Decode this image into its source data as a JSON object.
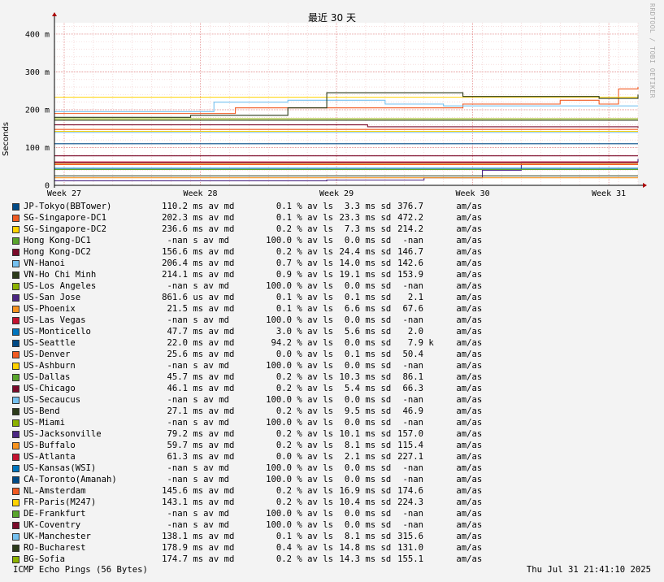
{
  "chart_data": {
    "type": "line",
    "title": "最近 30 天",
    "ylabel": "Seconds",
    "watermark": "RRDTOOL / TOBI OETIKER",
    "ylim": [
      0,
      430
    ],
    "yticks": [
      {
        "value": 0,
        "label": "0"
      },
      {
        "value": 100,
        "label": "100 m"
      },
      {
        "value": 200,
        "label": "200 m"
      },
      {
        "value": 300,
        "label": "300 m"
      },
      {
        "value": 400,
        "label": "400 m"
      }
    ],
    "xticks": [
      {
        "value": 0.5,
        "label": "Week 27"
      },
      {
        "value": 7.5,
        "label": "Week 28"
      },
      {
        "value": 14.5,
        "label": "Week 29"
      },
      {
        "value": 21.5,
        "label": "Week 30"
      },
      {
        "value": 28.5,
        "label": "Week 31"
      }
    ],
    "xlim": [
      0,
      30
    ],
    "grid": true,
    "series": [
      {
        "name": "JP-Tokyo(BBTower)",
        "color": "#004a86",
        "av": "110.2",
        "avu": "ms",
        "ls": "0.1",
        "sd": "3.3",
        "sdu": "ms",
        "sdv": "376.7",
        "sdvu": "",
        "levels": [
          [
            0,
            110
          ],
          [
            30,
            110
          ]
        ]
      },
      {
        "name": "SG-Singapore-DC1",
        "color": "#f15a22",
        "av": "202.3",
        "avu": "ms",
        "ls": "0.1",
        "sd": "23.3",
        "sdu": "ms",
        "sdv": "472.2",
        "sdvu": "",
        "levels": [
          [
            0,
            190
          ],
          [
            9,
            190
          ],
          [
            9.3,
            205
          ],
          [
            20,
            205
          ],
          [
            21,
            215
          ],
          [
            26,
            225
          ],
          [
            28,
            215
          ],
          [
            29,
            255
          ],
          [
            30,
            260
          ]
        ]
      },
      {
        "name": "SG-Singapore-DC2",
        "color": "#ffd200",
        "av": "236.6",
        "avu": "ms",
        "ls": "0.2",
        "sd": "7.3",
        "sdu": "ms",
        "sdv": "214.2",
        "sdvu": "",
        "levels": [
          [
            0,
            233
          ],
          [
            30,
            232
          ]
        ]
      },
      {
        "name": "Hong Kong-DC1",
        "color": "#59a52c",
        "av": "-nan",
        "avu": "s",
        "ls": "100.0",
        "sd": "0.0",
        "sdu": "ms",
        "sdv": "-nan",
        "sdvu": "",
        "levels": []
      },
      {
        "name": "Hong Kong-DC2",
        "color": "#7b0a2a",
        "av": "156.6",
        "avu": "ms",
        "ls": "0.2",
        "sd": "24.4",
        "sdu": "ms",
        "sdv": "146.7",
        "sdvu": "",
        "levels": [
          [
            0,
            160
          ],
          [
            16,
            160
          ],
          [
            16.1,
            155
          ],
          [
            30,
            152
          ]
        ]
      },
      {
        "name": "VN-Hanoi",
        "color": "#75c1f0",
        "av": "206.4",
        "avu": "ms",
        "ls": "0.7",
        "sd": "14.0",
        "sdu": "ms",
        "sdv": "142.6",
        "sdvu": "",
        "levels": [
          [
            0,
            195
          ],
          [
            8,
            195
          ],
          [
            8.2,
            220
          ],
          [
            12,
            225
          ],
          [
            17,
            215
          ],
          [
            20,
            210
          ],
          [
            30,
            210
          ]
        ]
      },
      {
        "name": "VN-Ho Chi Minh",
        "color": "#2c3b1a",
        "av": "214.1",
        "avu": "ms",
        "ls": "0.9",
        "sd": "19.1",
        "sdu": "ms",
        "sdv": "153.9",
        "sdvu": "",
        "levels": [
          [
            0,
            180
          ],
          [
            7,
            185
          ],
          [
            8,
            185
          ],
          [
            12,
            205
          ],
          [
            14,
            245
          ],
          [
            20,
            245
          ],
          [
            21,
            235
          ],
          [
            28,
            230
          ],
          [
            30,
            240
          ]
        ]
      },
      {
        "name": "US-Los Angeles",
        "color": "#8cb200",
        "av": "-nan",
        "avu": "s",
        "ls": "100.0",
        "sd": "0.0",
        "sdu": "ms",
        "sdv": "-nan",
        "sdvu": "",
        "levels": []
      },
      {
        "name": "US-San Jose",
        "color": "#4b2683",
        "av": "861.6",
        "avu": "us",
        "ls": "0.1",
        "sd": "0.1",
        "sdu": "ms",
        "sdv": "2.1",
        "sdvu": "",
        "levels": [
          [
            0,
            12
          ],
          [
            14,
            14
          ],
          [
            19,
            20
          ],
          [
            22,
            40
          ],
          [
            24,
            62
          ],
          [
            30,
            70
          ]
        ]
      },
      {
        "name": "US-Phoenix",
        "color": "#f7931e",
        "av": "21.5",
        "avu": "ms",
        "ls": "0.1",
        "sd": "6.6",
        "sdu": "ms",
        "sdv": "67.6",
        "sdvu": "",
        "levels": [
          [
            0,
            20
          ],
          [
            30,
            20
          ]
        ]
      },
      {
        "name": "US-Las Vegas",
        "color": "#c4122f",
        "av": "-nan",
        "avu": "s",
        "ls": "100.0",
        "sd": "0.0",
        "sdu": "ms",
        "sdv": "-nan",
        "sdvu": "",
        "levels": []
      },
      {
        "name": "US-Monticello",
        "color": "#0075be",
        "av": "47.7",
        "avu": "ms",
        "ls": "3.0",
        "sd": "5.6",
        "sdu": "ms",
        "sdv": "2.0",
        "sdvu": "",
        "levels": [
          [
            0,
            45
          ],
          [
            30,
            45
          ]
        ]
      },
      {
        "name": "US-Seattle",
        "color": "#004a86",
        "av": "22.0",
        "avu": "ms",
        "ls": "94.2",
        "sd": "0.0",
        "sdu": "ms",
        "sdv": "7.9",
        "sdvu": "k",
        "levels": []
      },
      {
        "name": "US-Denver",
        "color": "#f15a22",
        "av": "25.6",
        "avu": "ms",
        "ls": "0.0",
        "sd": "0.1",
        "sdu": "ms",
        "sdv": "50.4",
        "sdvu": "",
        "levels": [
          [
            0,
            55
          ],
          [
            30,
            55
          ]
        ]
      },
      {
        "name": "US-Ashburn",
        "color": "#ffd200",
        "av": "-nan",
        "avu": "s",
        "ls": "100.0",
        "sd": "0.0",
        "sdu": "ms",
        "sdv": "-nan",
        "sdvu": "",
        "levels": []
      },
      {
        "name": "US-Dallas",
        "color": "#59a52c",
        "av": "45.7",
        "avu": "ms",
        "ls": "0.2",
        "sd": "10.3",
        "sdu": "ms",
        "sdv": "86.1",
        "sdvu": "",
        "levels": [
          [
            0,
            42
          ],
          [
            30,
            42
          ]
        ]
      },
      {
        "name": "US-Chicago",
        "color": "#7b0a2a",
        "av": "46.1",
        "avu": "ms",
        "ls": "0.2",
        "sd": "5.4",
        "sdu": "ms",
        "sdv": "66.3",
        "sdvu": "",
        "levels": [
          [
            0,
            78
          ],
          [
            30,
            78
          ]
        ]
      },
      {
        "name": "US-Secaucus",
        "color": "#75c1f0",
        "av": "-nan",
        "avu": "s",
        "ls": "100.0",
        "sd": "0.0",
        "sdu": "ms",
        "sdv": "-nan",
        "sdvu": "",
        "levels": []
      },
      {
        "name": "US-Bend",
        "color": "#2c3b1a",
        "av": "27.1",
        "avu": "ms",
        "ls": "0.2",
        "sd": "9.5",
        "sdu": "ms",
        "sdv": "46.9",
        "sdvu": "",
        "levels": [
          [
            0,
            25
          ],
          [
            30,
            25
          ]
        ]
      },
      {
        "name": "US-Miami",
        "color": "#8cb200",
        "av": "-nan",
        "avu": "s",
        "ls": "100.0",
        "sd": "0.0",
        "sdu": "ms",
        "sdv": "-nan",
        "sdvu": "",
        "levels": []
      },
      {
        "name": "US-Jacksonville",
        "color": "#4b2683",
        "av": "79.2",
        "avu": "ms",
        "ls": "0.2",
        "sd": "10.1",
        "sdu": "ms",
        "sdv": "157.0",
        "sdvu": "",
        "levels": [
          [
            0,
            60
          ],
          [
            30,
            60
          ]
        ]
      },
      {
        "name": "US-Buffalo",
        "color": "#f7931e",
        "av": "59.7",
        "avu": "ms",
        "ls": "0.2",
        "sd": "8.1",
        "sdu": "ms",
        "sdv": "115.4",
        "sdvu": "",
        "levels": [
          [
            0,
            58
          ],
          [
            30,
            58
          ]
        ]
      },
      {
        "name": "US-Atlanta",
        "color": "#c4122f",
        "av": "61.3",
        "avu": "ms",
        "ls": "0.0",
        "sd": "2.1",
        "sdu": "ms",
        "sdv": "227.1",
        "sdvu": "",
        "levels": [
          [
            0,
            62
          ],
          [
            30,
            62
          ]
        ]
      },
      {
        "name": "US-Kansas(WSI)",
        "color": "#0075be",
        "av": "-nan",
        "avu": "s",
        "ls": "100.0",
        "sd": "0.0",
        "sdu": "ms",
        "sdv": "-nan",
        "sdvu": "",
        "levels": []
      },
      {
        "name": "CA-Toronto(Amanah)",
        "color": "#004a86",
        "av": "-nan",
        "avu": "s",
        "ls": "100.0",
        "sd": "0.0",
        "sdu": "ms",
        "sdv": "-nan",
        "sdvu": "",
        "levels": []
      },
      {
        "name": "NL-Amsterdam",
        "color": "#f15a22",
        "av": "145.6",
        "avu": "ms",
        "ls": "0.2",
        "sd": "16.9",
        "sdu": "ms",
        "sdv": "174.6",
        "sdvu": "",
        "levels": [
          [
            0,
            148
          ],
          [
            30,
            148
          ]
        ]
      },
      {
        "name": "FR-Paris(M247)",
        "color": "#ffd200",
        "av": "143.1",
        "avu": "ms",
        "ls": "0.2",
        "sd": "10.4",
        "sdu": "ms",
        "sdv": "224.3",
        "sdvu": "",
        "levels": [
          [
            0,
            143
          ],
          [
            30,
            143
          ]
        ]
      },
      {
        "name": "DE-Frankfurt",
        "color": "#59a52c",
        "av": "-nan",
        "avu": "s",
        "ls": "100.0",
        "sd": "0.0",
        "sdu": "ms",
        "sdv": "-nan",
        "sdvu": "",
        "levels": []
      },
      {
        "name": "UK-Coventry",
        "color": "#7b0a2a",
        "av": "-nan",
        "avu": "s",
        "ls": "100.0",
        "sd": "0.0",
        "sdu": "ms",
        "sdv": "-nan",
        "sdvu": "",
        "levels": []
      },
      {
        "name": "UK-Manchester",
        "color": "#75c1f0",
        "av": "138.1",
        "avu": "ms",
        "ls": "0.1",
        "sd": "8.1",
        "sdu": "ms",
        "sdv": "315.6",
        "sdvu": "",
        "levels": [
          [
            0,
            140
          ],
          [
            30,
            140
          ]
        ]
      },
      {
        "name": "RO-Bucharest",
        "color": "#2c3b1a",
        "av": "178.9",
        "avu": "ms",
        "ls": "0.4",
        "sd": "14.8",
        "sdu": "ms",
        "sdv": "131.0",
        "sdvu": "",
        "levels": [
          [
            0,
            172
          ],
          [
            30,
            172
          ]
        ]
      },
      {
        "name": "BG-Sofia",
        "color": "#8cb200",
        "av": "174.7",
        "avu": "ms",
        "ls": "0.2",
        "sd": "14.3",
        "sdu": "ms",
        "sdv": "155.1",
        "sdvu": "",
        "levels": [
          [
            0,
            176
          ],
          [
            30,
            176
          ]
        ]
      }
    ],
    "labels": {
      "av": "av md",
      "ls": "% av ls",
      "sd": "sd",
      "unit": "am/as"
    }
  },
  "footer": {
    "left": "ICMP Echo Pings (56 Bytes)",
    "right": "Thu Jul 31 21:41:10 2025"
  }
}
